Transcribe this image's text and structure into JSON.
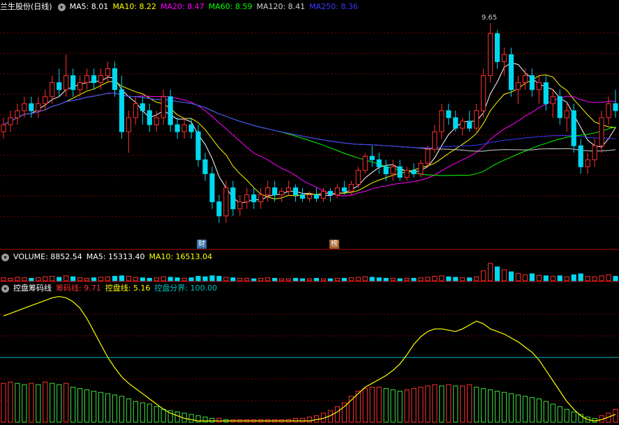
{
  "main_header": {
    "stock_name": "兰生股份(日线)",
    "ma": [
      {
        "label": "MA5: 8.01",
        "color": "#ffffff"
      },
      {
        "label": "MA10: 8.22",
        "color": "#ffff00"
      },
      {
        "label": "MA20: 8.47",
        "color": "#ff00ff"
      },
      {
        "label": "MA60: 8.59",
        "color": "#00ff00"
      },
      {
        "label": "MA120: 8.41",
        "color": "#d0d0d0"
      },
      {
        "label": "MA250: 8.36",
        "color": "#3a3aff"
      }
    ]
  },
  "volume_header": {
    "title": "VOLUME: 8852.54",
    "ma5": "MA5: 15313.40",
    "ma10": "MA10: 16513.04"
  },
  "indicator_header": {
    "title": "控盘筹码线",
    "chip_line": "筹码线: 9.71",
    "control_line": "控盘线: 5.16",
    "boundary": "控盘分界: 100.00"
  },
  "badges": [
    {
      "text": "财",
      "color": "#3a6ea5"
    },
    {
      "text": "榜",
      "color": "#a5622a"
    }
  ],
  "peak_label": "9.65",
  "colors": {
    "up": "#ff3030",
    "down": "#00d8f0",
    "grid": "#7a0000",
    "separator": "#b00000",
    "boundary_line": "#00c0c0",
    "control_line": "#ffff00"
  },
  "chart_data": {
    "type": "candlestick",
    "price_range": [
      6.6,
      9.8
    ],
    "candles": [
      [
        8.1,
        8.3,
        8.0,
        8.2
      ],
      [
        8.2,
        8.4,
        8.1,
        8.3
      ],
      [
        8.3,
        8.5,
        8.2,
        8.4
      ],
      [
        8.4,
        8.6,
        8.3,
        8.5
      ],
      [
        8.5,
        8.6,
        8.3,
        8.4
      ],
      [
        8.4,
        8.6,
        8.3,
        8.5
      ],
      [
        8.5,
        8.7,
        8.4,
        8.6
      ],
      [
        8.6,
        8.9,
        8.5,
        8.8
      ],
      [
        8.8,
        9.0,
        8.6,
        8.7
      ],
      [
        8.7,
        9.2,
        8.6,
        8.9
      ],
      [
        8.9,
        9.0,
        8.6,
        8.7
      ],
      [
        8.7,
        8.9,
        8.6,
        8.8
      ],
      [
        8.8,
        9.0,
        8.7,
        8.9
      ],
      [
        8.9,
        9.0,
        8.7,
        8.8
      ],
      [
        8.8,
        9.0,
        8.7,
        8.9
      ],
      [
        8.9,
        9.1,
        8.8,
        9.0
      ],
      [
        9.0,
        9.1,
        8.6,
        8.7
      ],
      [
        8.7,
        8.9,
        8.0,
        8.1
      ],
      [
        8.1,
        8.4,
        7.8,
        8.3
      ],
      [
        8.3,
        8.6,
        8.2,
        8.5
      ],
      [
        8.5,
        8.6,
        8.2,
        8.4
      ],
      [
        8.4,
        8.5,
        8.1,
        8.2
      ],
      [
        8.2,
        8.4,
        8.1,
        8.3
      ],
      [
        8.3,
        8.7,
        8.2,
        8.6
      ],
      [
        8.6,
        8.7,
        8.1,
        8.2
      ],
      [
        8.2,
        8.3,
        8.0,
        8.1
      ],
      [
        8.1,
        8.3,
        8.0,
        8.2
      ],
      [
        8.2,
        8.3,
        8.0,
        8.1
      ],
      [
        8.1,
        8.2,
        7.6,
        7.7
      ],
      [
        7.7,
        7.8,
        7.4,
        7.5
      ],
      [
        7.5,
        7.6,
        7.0,
        7.1
      ],
      [
        7.1,
        7.2,
        6.8,
        6.9
      ],
      [
        6.9,
        7.4,
        6.8,
        7.3
      ],
      [
        7.3,
        7.4,
        6.9,
        7.0
      ],
      [
        7.0,
        7.2,
        6.9,
        7.1
      ],
      [
        7.1,
        7.3,
        7.0,
        7.2
      ],
      [
        7.2,
        7.3,
        7.0,
        7.1
      ],
      [
        7.1,
        7.3,
        7.0,
        7.2
      ],
      [
        7.2,
        7.4,
        7.1,
        7.3
      ],
      [
        7.3,
        7.4,
        7.1,
        7.2
      ],
      [
        7.2,
        7.3,
        7.1,
        7.25
      ],
      [
        7.25,
        7.4,
        7.2,
        7.3
      ],
      [
        7.3,
        7.35,
        7.1,
        7.2
      ],
      [
        7.2,
        7.3,
        7.1,
        7.15
      ],
      [
        7.15,
        7.25,
        7.1,
        7.2
      ],
      [
        7.2,
        7.3,
        7.1,
        7.15
      ],
      [
        7.15,
        7.3,
        7.1,
        7.25
      ],
      [
        7.25,
        7.3,
        7.1,
        7.2
      ],
      [
        7.2,
        7.35,
        7.15,
        7.3
      ],
      [
        7.3,
        7.4,
        7.2,
        7.25
      ],
      [
        7.25,
        7.4,
        7.2,
        7.35
      ],
      [
        7.35,
        7.6,
        7.3,
        7.55
      ],
      [
        7.55,
        7.8,
        7.5,
        7.75
      ],
      [
        7.75,
        7.9,
        7.6,
        7.7
      ],
      [
        7.7,
        7.8,
        7.5,
        7.6
      ],
      [
        7.6,
        7.7,
        7.4,
        7.5
      ],
      [
        7.5,
        7.7,
        7.4,
        7.6
      ],
      [
        7.6,
        7.7,
        7.4,
        7.45
      ],
      [
        7.45,
        7.6,
        7.4,
        7.55
      ],
      [
        7.55,
        7.65,
        7.45,
        7.5
      ],
      [
        7.5,
        7.7,
        7.45,
        7.65
      ],
      [
        7.65,
        7.9,
        7.6,
        7.85
      ],
      [
        7.85,
        8.2,
        7.8,
        8.1
      ],
      [
        8.1,
        8.5,
        8.0,
        8.4
      ],
      [
        8.4,
        8.5,
        8.2,
        8.3
      ],
      [
        8.3,
        8.4,
        8.1,
        8.15
      ],
      [
        8.15,
        8.3,
        8.05,
        8.25
      ],
      [
        8.25,
        8.4,
        8.1,
        8.15
      ],
      [
        8.15,
        8.5,
        8.1,
        8.4
      ],
      [
        8.4,
        9.0,
        8.3,
        8.9
      ],
      [
        8.9,
        9.65,
        8.8,
        9.5
      ],
      [
        9.5,
        9.55,
        9.0,
        9.1
      ],
      [
        9.1,
        9.3,
        8.9,
        9.2
      ],
      [
        9.2,
        9.3,
        8.6,
        8.7
      ],
      [
        8.7,
        8.9,
        8.5,
        8.8
      ],
      [
        8.8,
        9.0,
        8.7,
        8.9
      ],
      [
        8.9,
        9.0,
        8.6,
        8.7
      ],
      [
        8.7,
        8.9,
        8.5,
        8.8
      ],
      [
        8.8,
        8.9,
        8.4,
        8.5
      ],
      [
        8.5,
        8.7,
        8.3,
        8.6
      ],
      [
        8.6,
        8.7,
        8.2,
        8.3
      ],
      [
        8.3,
        8.5,
        8.1,
        8.4
      ],
      [
        8.4,
        8.5,
        7.8,
        7.9
      ],
      [
        7.9,
        8.0,
        7.5,
        7.6
      ],
      [
        7.6,
        7.8,
        7.5,
        7.7
      ],
      [
        7.7,
        8.0,
        7.6,
        7.9
      ],
      [
        7.9,
        8.4,
        7.8,
        8.3
      ],
      [
        8.3,
        8.6,
        8.2,
        8.5
      ],
      [
        8.5,
        8.7,
        8.3,
        8.4
      ]
    ],
    "volume": [
      6,
      5,
      7,
      6,
      5,
      6,
      8,
      9,
      7,
      10,
      8,
      6,
      5,
      6,
      7,
      8,
      9,
      10,
      9,
      7,
      6,
      5,
      6,
      8,
      7,
      6,
      5,
      6,
      9,
      8,
      10,
      9,
      7,
      6,
      5,
      5,
      4,
      5,
      6,
      5,
      4,
      4,
      5,
      4,
      4,
      5,
      4,
      4,
      5,
      5,
      6,
      7,
      8,
      7,
      6,
      5,
      5,
      4,
      5,
      5,
      6,
      7,
      9,
      10,
      8,
      7,
      6,
      6,
      8,
      20,
      35,
      28,
      22,
      18,
      15,
      12,
      14,
      11,
      10,
      9,
      10,
      8,
      12,
      14,
      9,
      8,
      10,
      12,
      9
    ],
    "chip_line": [
      0.82,
      0.84,
      0.86,
      0.88,
      0.9,
      0.92,
      0.94,
      0.96,
      0.97,
      0.96,
      0.93,
      0.88,
      0.8,
      0.7,
      0.6,
      0.5,
      0.42,
      0.35,
      0.3,
      0.26,
      0.22,
      0.18,
      0.14,
      0.1,
      0.07,
      0.05,
      0.03,
      0.02,
      0.01,
      0.01,
      0.01,
      0.01,
      0.01,
      0.01,
      0.01,
      0.01,
      0.01,
      0.01,
      0.01,
      0.01,
      0.01,
      0.01,
      0.01,
      0.01,
      0.01,
      0.02,
      0.03,
      0.05,
      0.08,
      0.12,
      0.17,
      0.22,
      0.27,
      0.3,
      0.33,
      0.36,
      0.4,
      0.45,
      0.52,
      0.6,
      0.66,
      0.7,
      0.72,
      0.72,
      0.71,
      0.7,
      0.72,
      0.75,
      0.78,
      0.76,
      0.72,
      0.7,
      0.68,
      0.65,
      0.62,
      0.58,
      0.54,
      0.48,
      0.4,
      0.32,
      0.24,
      0.16,
      0.1,
      0.05,
      0.02,
      0.01,
      0.02,
      0.04,
      0.06
    ],
    "control_bars": [
      0.3,
      0.31,
      0.3,
      0.29,
      0.3,
      0.29,
      0.31,
      0.3,
      0.29,
      0.3,
      0.27,
      0.26,
      0.25,
      0.24,
      0.23,
      0.22,
      0.21,
      0.2,
      0.18,
      0.16,
      0.15,
      0.14,
      0.12,
      0.1,
      0.09,
      0.08,
      0.07,
      0.06,
      0.05,
      0.04,
      0.03,
      0.03,
      0.02,
      0.02,
      0.02,
      0.02,
      0.02,
      0.02,
      0.02,
      0.02,
      0.02,
      0.02,
      0.03,
      0.03,
      0.04,
      0.05,
      0.07,
      0.09,
      0.12,
      0.15,
      0.2,
      0.24,
      0.26,
      0.27,
      0.27,
      0.26,
      0.25,
      0.24,
      0.25,
      0.26,
      0.27,
      0.28,
      0.29,
      0.28,
      0.29,
      0.28,
      0.28,
      0.29,
      0.27,
      0.26,
      0.25,
      0.24,
      0.23,
      0.22,
      0.21,
      0.2,
      0.19,
      0.18,
      0.16,
      0.14,
      0.12,
      0.1,
      0.08,
      0.06,
      0.04,
      0.03,
      0.05,
      0.07,
      0.1
    ],
    "boundary_level": 0.5
  }
}
